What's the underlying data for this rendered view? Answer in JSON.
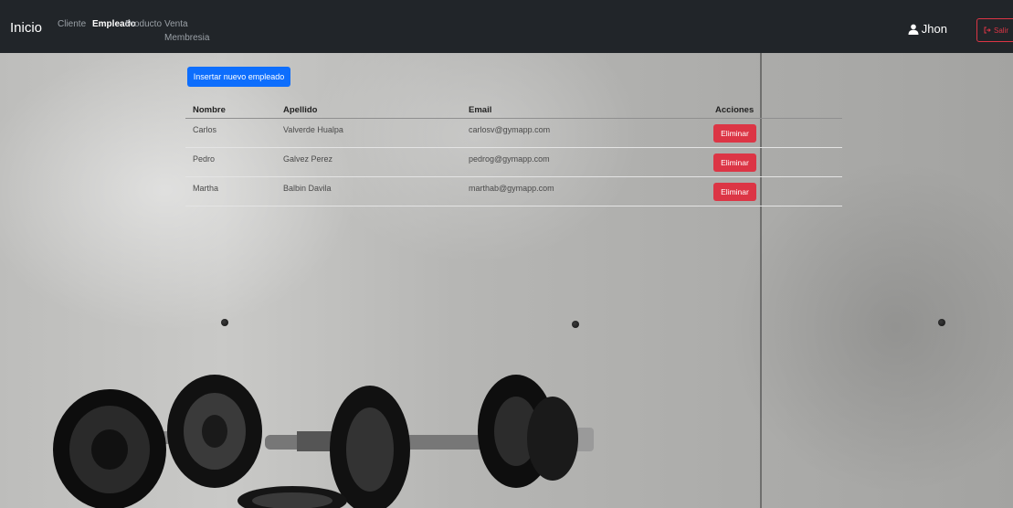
{
  "navbar": {
    "brand": "Inicio",
    "links": [
      "Cliente",
      "Empleado",
      "Producto",
      "Venta",
      "Membresia"
    ],
    "active": "Empleado",
    "user": "Jhon",
    "logout": "Salir"
  },
  "main": {
    "insert_button": "Insertar nuevo empleado",
    "table": {
      "headers": [
        "Nombre",
        "Apellido",
        "Email",
        "Acciones"
      ],
      "rows": [
        {
          "nombre": "Carlos",
          "apellido": "Valverde Hualpa",
          "email": "carlosv@gymapp.com",
          "action": "Eliminar"
        },
        {
          "nombre": "Pedro",
          "apellido": "Galvez Perez",
          "email": "pedrog@gymapp.com",
          "action": "Eliminar"
        },
        {
          "nombre": "Martha",
          "apellido": "Balbin Davila",
          "email": "marthab@gymapp.com",
          "action": "Eliminar"
        }
      ]
    }
  },
  "colors": {
    "navbar_bg": "#212529",
    "primary": "#0d6efd",
    "danger": "#dc3545"
  },
  "icons": {
    "user": "user-icon",
    "logout": "sign-out-icon"
  }
}
